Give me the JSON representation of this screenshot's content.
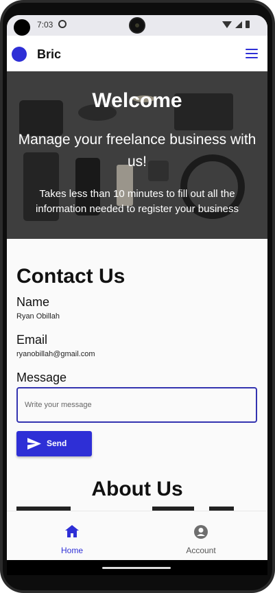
{
  "status_bar": {
    "time": "7:03"
  },
  "app_bar": {
    "brand": "Bric"
  },
  "hero": {
    "title": "Welcome",
    "subtitle": "Manage your freelance business with us!",
    "description": "Takes less than 10 minutes to fill out all the information needed to register your business"
  },
  "contact": {
    "title": "Contact Us",
    "name_label": "Name",
    "name_value": "Ryan Obillah",
    "email_label": "Email",
    "email_value": "ryanobillah@gmail.com",
    "message_label": "Message",
    "message_placeholder": "Write your message",
    "send_label": "Send"
  },
  "about": {
    "title": "About Us"
  },
  "bottom_nav": {
    "items": [
      {
        "label": "Home",
        "icon": "home-icon",
        "active": true
      },
      {
        "label": "Account",
        "icon": "account-icon",
        "active": false
      }
    ]
  },
  "colors": {
    "accent": "#2e2fd6",
    "inactive": "#6e6e6e"
  }
}
